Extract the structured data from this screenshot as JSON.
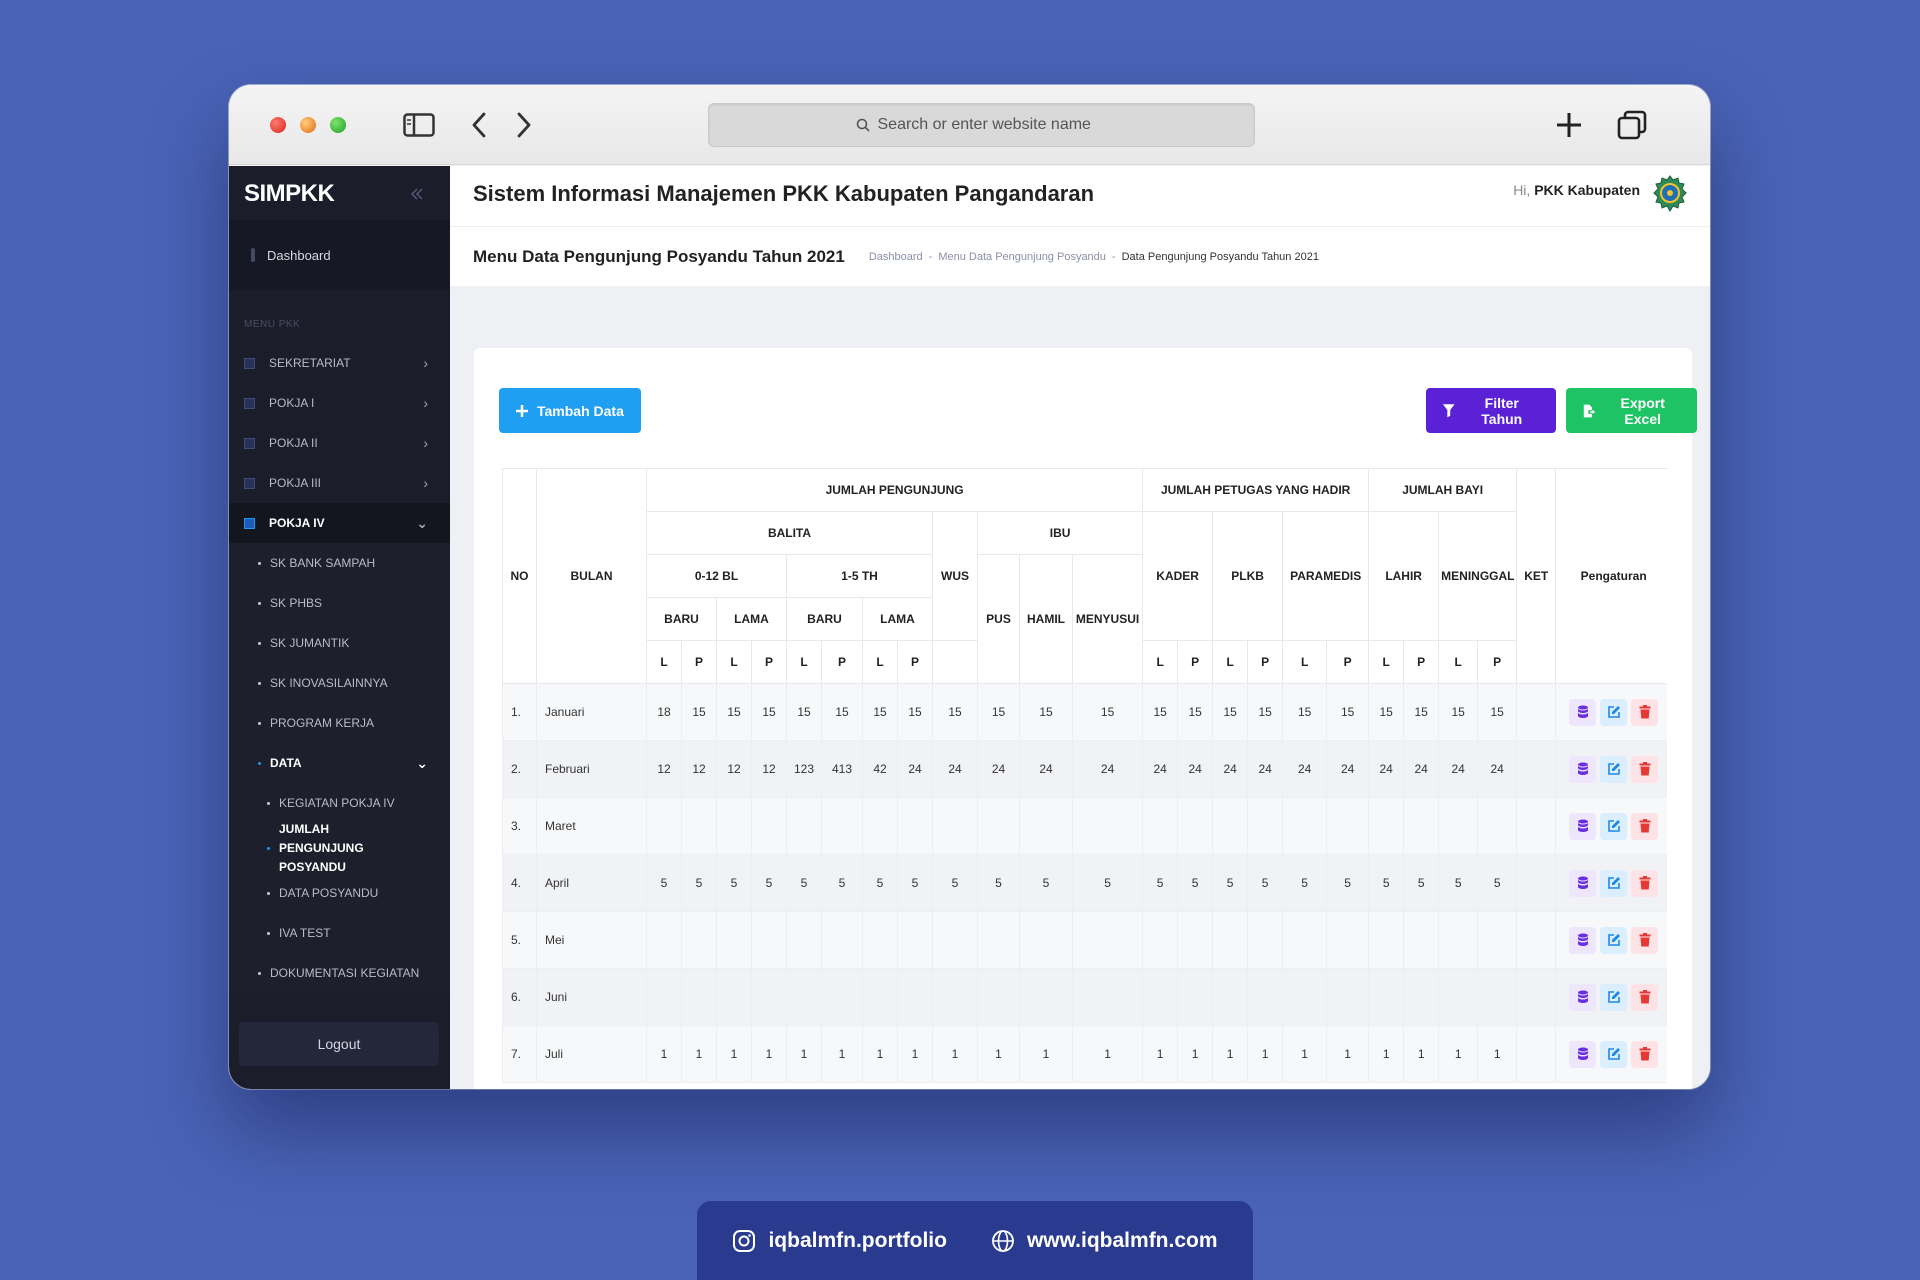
{
  "browser": {
    "search_placeholder": "Search or enter website name"
  },
  "sidebar": {
    "brand": "SIMPKK",
    "dashboard": "Dashboard",
    "caption": "MENU PKK",
    "menu": [
      {
        "label": "SEKRETARIAT"
      },
      {
        "label": "POKJA I"
      },
      {
        "label": "POKJA II"
      },
      {
        "label": "POKJA III"
      },
      {
        "label": "POKJA IV"
      }
    ],
    "pokja4_items": [
      {
        "label": "SK BANK SAMPAH"
      },
      {
        "label": "SK PHBS"
      },
      {
        "label": "SK JUMANTIK"
      },
      {
        "label": "SK INOVASILAINNYA"
      },
      {
        "label": "PROGRAM KERJA"
      },
      {
        "label": "DATA"
      }
    ],
    "data_items": [
      {
        "label": "KEGIATAN POKJA IV"
      },
      {
        "label": "JUMLAH PENGUNJUNG POSYANDU"
      },
      {
        "label": "DATA POSYANDU"
      },
      {
        "label": "IVA TEST"
      }
    ],
    "dokumentasi": "DOKUMENTASI KEGIATAN",
    "logout": "Logout"
  },
  "header": {
    "app_title": "Sistem Informasi Manajemen PKK Kabupaten Pangandaran",
    "greet_prefix": "Hi,",
    "greet_name": "PKK Kabupaten"
  },
  "subheader": {
    "page_title": "Menu Data Pengunjung Posyandu Tahun 2021",
    "breadcrumb": [
      "Dashboard",
      "Menu Data Pengunjung Posyandu",
      "Data Pengunjung Posyandu Tahun 2021"
    ],
    "sep": "-"
  },
  "buttons": {
    "add": "Tambah Data",
    "filter": "Filter Tahun",
    "export": "Export Excel"
  },
  "table": {
    "h": {
      "no": "NO",
      "bulan": "BULAN",
      "jumlah_pengunjung": "JUMLAH PENGUNJUNG",
      "jumlah_petugas": "JUMLAH PETUGAS YANG HADIR",
      "jumlah_bayi": "JUMLAH BAYI",
      "balita": "BALITA",
      "ibu": "IBU",
      "bl": "0-12 BL",
      "th": "1-5 TH",
      "wus": "WUS",
      "pus": "PUS",
      "hamil": "HAMIL",
      "menyusui": "MENYUSUI",
      "kader": "KADER",
      "plkb": "PLKB",
      "paramedis": "PARAMEDIS",
      "lahir": "LAHIR",
      "meninggal": "MENINGGAL",
      "ket": "KET",
      "pengaturan": "Pengaturan",
      "baru": "BARU",
      "lama": "LAMA",
      "l": "L",
      "p": "P"
    },
    "rows": [
      {
        "no": "1.",
        "bulan": "Januari",
        "v": [
          "18",
          "15",
          "15",
          "15",
          "15",
          "15",
          "15",
          "15",
          "15",
          "15",
          "15",
          "15",
          "15",
          "15",
          "15",
          "15",
          "15",
          "15",
          "15",
          "15",
          "15",
          "15"
        ]
      },
      {
        "no": "2.",
        "bulan": "Februari",
        "v": [
          "12",
          "12",
          "12",
          "12",
          "123",
          "413",
          "42",
          "24",
          "24",
          "24",
          "24",
          "24",
          "24",
          "24",
          "24",
          "24",
          "24",
          "24",
          "24",
          "24",
          "24",
          "24"
        ]
      },
      {
        "no": "3.",
        "bulan": "Maret",
        "v": [
          "",
          "",
          "",
          "",
          "",
          "",
          "",
          "",
          "",
          "",
          "",
          "",
          "",
          "",
          "",
          "",
          "",
          "",
          "",
          "",
          "",
          ""
        ]
      },
      {
        "no": "4.",
        "bulan": "April",
        "v": [
          "5",
          "5",
          "5",
          "5",
          "5",
          "5",
          "5",
          "5",
          "5",
          "5",
          "5",
          "5",
          "5",
          "5",
          "5",
          "5",
          "5",
          "5",
          "5",
          "5",
          "5",
          "5"
        ]
      },
      {
        "no": "5.",
        "bulan": "Mei",
        "v": [
          "",
          "",
          "",
          "",
          "",
          "",
          "",
          "",
          "",
          "",
          "",
          "",
          "",
          "",
          "",
          "",
          "",
          "",
          "",
          "",
          "",
          ""
        ]
      },
      {
        "no": "6.",
        "bulan": "Juni",
        "v": [
          "",
          "",
          "",
          "",
          "",
          "",
          "",
          "",
          "",
          "",
          "",
          "",
          "",
          "",
          "",
          "",
          "",
          "",
          "",
          "",
          "",
          ""
        ]
      },
      {
        "no": "7.",
        "bulan": "Juli",
        "v": [
          "1",
          "1",
          "1",
          "1",
          "1",
          "1",
          "1",
          "1",
          "1",
          "1",
          "1",
          "1",
          "1",
          "1",
          "1",
          "1",
          "1",
          "1",
          "1",
          "1",
          "1",
          "1"
        ]
      }
    ]
  },
  "footer": {
    "instagram": "iqbalmfn.portfolio",
    "website": "www.iqbalmfn.com"
  },
  "colors": {
    "background": "#4a63b5",
    "sidebar": "#1b1d2b",
    "add_button": "#1e9ff2",
    "filter_button": "#5b21d6",
    "export_button": "#1ec464"
  }
}
